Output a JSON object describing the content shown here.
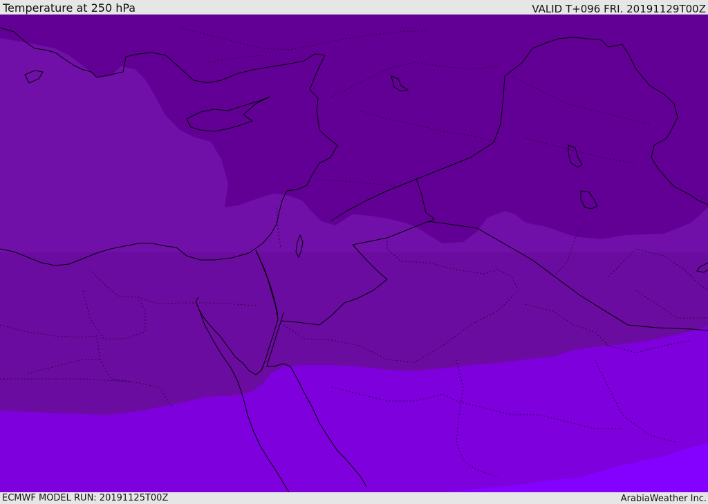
{
  "header": {
    "title": "Temperature at 250 hPa",
    "valid": "VALID T+096 FRI. 20191129T00Z"
  },
  "footer": {
    "model_run": "ECMWF MODEL RUN: 20191125T00Z",
    "provider": "ArabiaWeather Inc."
  },
  "colors": {
    "band_coldest": "#620096",
    "band_cold": "#7010a8",
    "band_mid": "#6b0ca0",
    "band_warm": "#7e00dc",
    "band_warmest": "#8400ff",
    "coastline": "#000000",
    "border": "#000000"
  }
}
